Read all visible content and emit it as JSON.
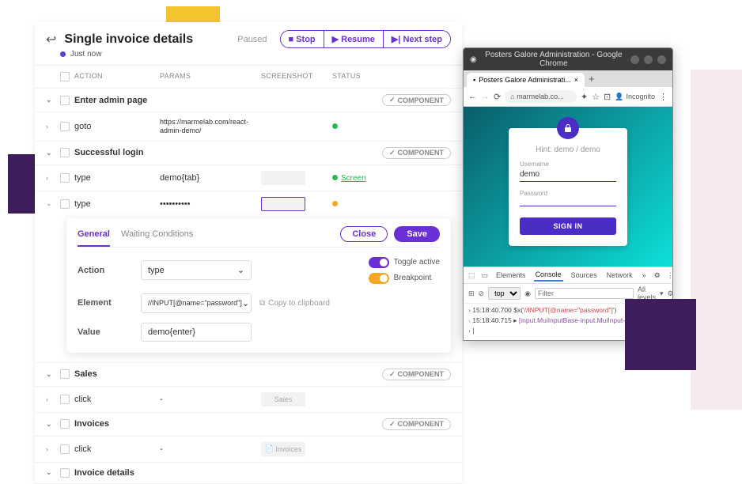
{
  "header": {
    "title": "Single invoice details",
    "paused": "Paused",
    "stop": "Stop",
    "resume": "Resume",
    "next_step": "Next step",
    "timestamp": "Just now"
  },
  "columns": {
    "action": "ACTION",
    "params": "PARAMS",
    "screenshot": "SCREENSHOT",
    "status": "STATUS"
  },
  "component_label": "COMPONENT",
  "groups": [
    {
      "name": "Enter admin page"
    },
    {
      "name": "Successful login"
    },
    {
      "name": "Sales"
    },
    {
      "name": "Invoices"
    },
    {
      "name": "Invoice details"
    }
  ],
  "steps": {
    "goto": {
      "action": "goto",
      "params": "https://marmelab.com/react-admin-demo/"
    },
    "type1": {
      "action": "type",
      "params": "demo{tab}",
      "status": "Screen"
    },
    "type2": {
      "action": "type",
      "params": "••••••••••"
    },
    "click_sales": {
      "action": "click",
      "params": "-",
      "thumb": "Sales"
    },
    "click_invoices": {
      "action": "click",
      "params": "-",
      "thumb": "Invoices"
    }
  },
  "editor": {
    "tabs": {
      "general": "General",
      "waiting": "Waiting Conditions"
    },
    "close": "Close",
    "save": "Save",
    "action_label": "Action",
    "action_value": "type",
    "element_label": "Element",
    "element_value": "//INPUT[@name=\"password\"]",
    "value_label": "Value",
    "value_value": "demo{enter}",
    "copy": "Copy to clipboard",
    "toggle_active": "Toggle active",
    "breakpoint": "Breakpoint"
  },
  "browser": {
    "window_title": "Posters Galore Administration - Google Chrome",
    "tab_title": "Posters Galore Administrati...",
    "url": "marmelab.co...",
    "incognito": "Incognito",
    "login": {
      "hint": "Hint: demo / demo",
      "username_label": "Username",
      "username_value": "demo",
      "password_label": "Password",
      "signin": "SIGN IN"
    },
    "devtools": {
      "tabs": {
        "elements": "Elements",
        "console": "Console",
        "sources": "Sources",
        "network": "Network"
      },
      "context": "top",
      "filter_placeholder": "Filter",
      "levels": "All levels",
      "line1_ts": "15:18:40.700",
      "line1_cmd": "$x(",
      "line1_arg": "'//INPUT[@name=\"password\"]'",
      "line1_end": ")",
      "line2_ts": "15:18:40.715",
      "line2_out": "[input.MuiInputBase-input.MuiInput-input]"
    }
  }
}
